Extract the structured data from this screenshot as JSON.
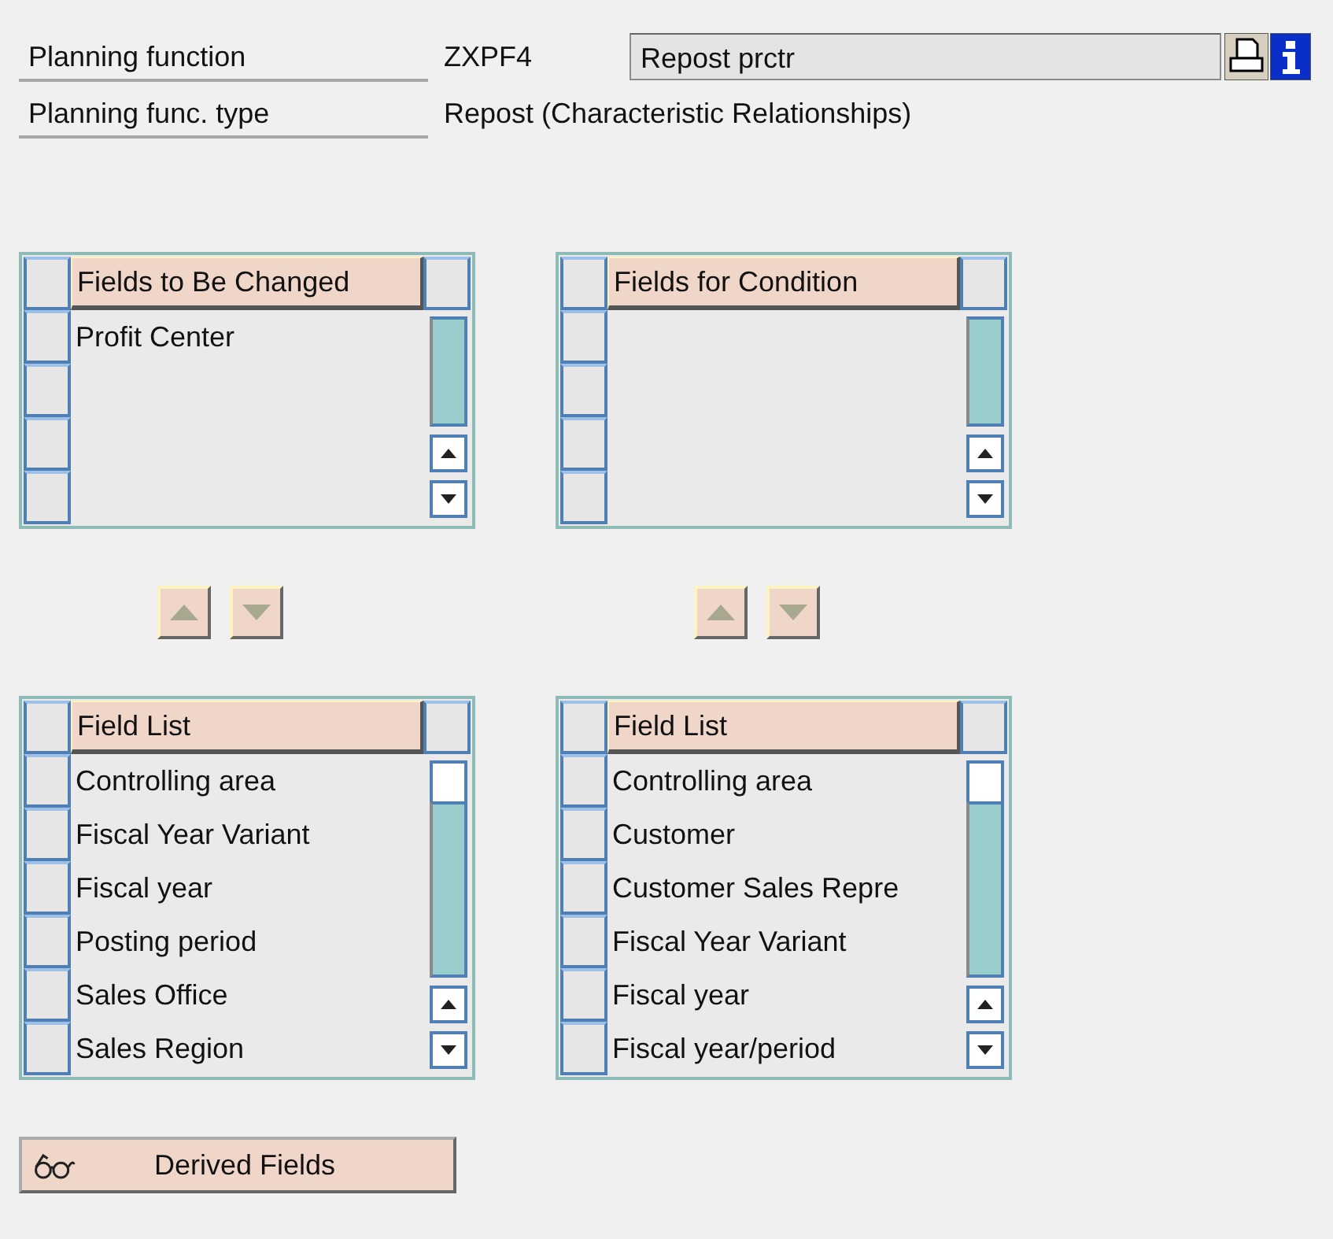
{
  "header": {
    "rows": [
      {
        "label": "Planning function",
        "value": "ZXPF4",
        "description": "Repost prctr"
      },
      {
        "label": "Planning func. type",
        "value": "Repost (Characteristic Relationships)"
      }
    ]
  },
  "lists": [
    {
      "kind": "selection",
      "title": "Fields to Be Changed",
      "rows": [
        "Profit Center"
      ]
    },
    {
      "kind": "selection",
      "title": "Fields for Condition"
    },
    {
      "kind": "field_list",
      "title": "Field List",
      "rows": [
        "Controlling area",
        "Fiscal Year Variant",
        "Fiscal year",
        "Posting period",
        "Sales Office",
        "Sales Region"
      ]
    },
    {
      "kind": "field_list",
      "title": "Field List",
      "rows": [
        "Controlling area",
        "Customer",
        "Customer Sales Repre",
        "Fiscal Year Variant",
        "Fiscal year",
        "Fiscal year/period"
      ]
    }
  ],
  "derived_button": {
    "label": "Derived Fields"
  }
}
